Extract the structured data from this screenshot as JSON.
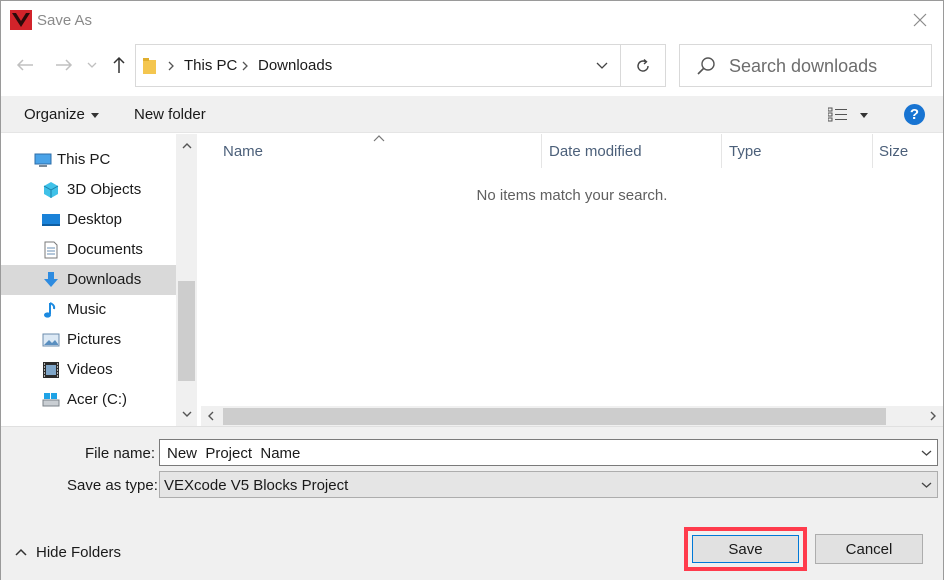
{
  "window": {
    "title": "Save As"
  },
  "address": {
    "crumbs": [
      "This PC",
      "Downloads"
    ]
  },
  "search": {
    "placeholder": "Search downloads"
  },
  "toolbar": {
    "organize_label": "Organize",
    "new_folder_label": "New folder",
    "help_label": "?"
  },
  "navpane": {
    "root": "This PC",
    "items": [
      {
        "label": "3D Objects",
        "icon": "3d-objects-icon"
      },
      {
        "label": "Desktop",
        "icon": "desktop-icon"
      },
      {
        "label": "Documents",
        "icon": "documents-icon"
      },
      {
        "label": "Downloads",
        "icon": "downloads-icon",
        "selected": true
      },
      {
        "label": "Music",
        "icon": "music-icon"
      },
      {
        "label": "Pictures",
        "icon": "pictures-icon"
      },
      {
        "label": "Videos",
        "icon": "videos-icon"
      },
      {
        "label": "Acer (C:)",
        "icon": "drive-icon"
      }
    ]
  },
  "filelist": {
    "columns": [
      "Name",
      "Date modified",
      "Type",
      "Size"
    ],
    "empty_message": "No items match your search."
  },
  "form": {
    "file_name_label": "File name:",
    "file_name_value": "New  Project  Name",
    "save_type_label": "Save as type:",
    "save_type_value": "VEXcode V5 Blocks Project"
  },
  "footer": {
    "hide_folders_label": "Hide Folders",
    "save_label": "Save",
    "cancel_label": "Cancel"
  },
  "colors": {
    "accent": "#0078d7",
    "highlight": "#ff3b4c",
    "help_blue": "#1874d2",
    "logo_red": "#d2232a"
  }
}
